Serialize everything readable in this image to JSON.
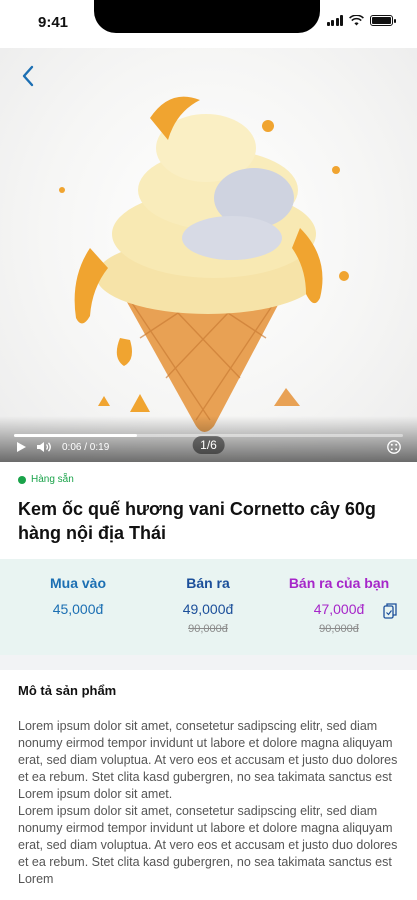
{
  "status_bar": {
    "time": "9:41"
  },
  "media": {
    "counter": "1/6",
    "time": "0:06 / 0:19",
    "progress": 0.316
  },
  "product": {
    "stock_label": "Hàng sẵn",
    "title": "Kem ốc quế hương vani Cornetto cây 60g hàng nội địa Thái"
  },
  "prices": {
    "buy": {
      "label": "Mua vào",
      "value": "45,000đ",
      "color": "#1c6fb3"
    },
    "sell": {
      "label": "Bán ra",
      "value": "49,000đ",
      "old": "90,000đ",
      "color": "#1c4f9a"
    },
    "your_sell": {
      "label": "Bán ra của bạn",
      "value": "47,000đ",
      "old": "90,000đ",
      "color": "#a626c9"
    }
  },
  "description": {
    "title": "Mô tả sản phẩm",
    "paragraphs": [
      "Lorem ipsum dolor sit amet, consetetur sadipscing elitr, sed diam nonumy eirmod tempor invidunt ut labore et dolore magna aliquyam erat, sed diam voluptua. At vero eos et accusam et justo duo dolores et ea rebum. Stet clita kasd gubergren, no sea takimata sanctus est Lorem ipsum dolor sit amet.",
      "Lorem ipsum dolor sit amet, consetetur sadipscing elitr, sed diam nonumy eirmod tempor invidunt ut labore et dolore magna aliquyam erat, sed diam voluptua. At vero eos et accusam et justo duo dolores et ea rebum. Stet clita kasd gubergren, no sea takimata sanctus est Lorem"
    ]
  },
  "colors": {
    "accent": "#1c6fb3",
    "in_stock": "#1aa34a",
    "panel_bg": "#e9f4f2"
  },
  "icons": [
    "back-arrow-icon",
    "play-icon",
    "volume-icon",
    "fullscreen-icon",
    "copy-icon",
    "signal-icon",
    "wifi-icon",
    "battery-icon"
  ]
}
